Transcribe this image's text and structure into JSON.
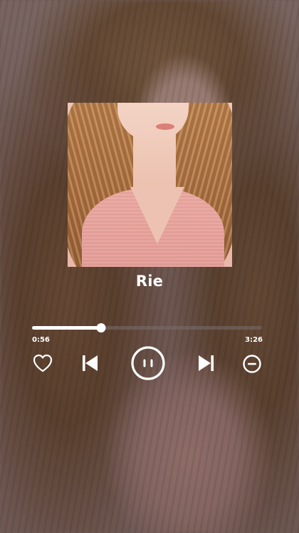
{
  "player": {
    "song_title": "Rie",
    "elapsed": "0:56",
    "total": "3:26",
    "progress_fraction": 0.3
  },
  "icons": {
    "like": "heart-icon",
    "previous": "skip-previous-icon",
    "play_pause": "pause-icon",
    "next": "skip-next-icon",
    "remove": "minus-circle-icon"
  },
  "colors": {
    "foreground": "#ffffff",
    "track": "#786e6e"
  }
}
